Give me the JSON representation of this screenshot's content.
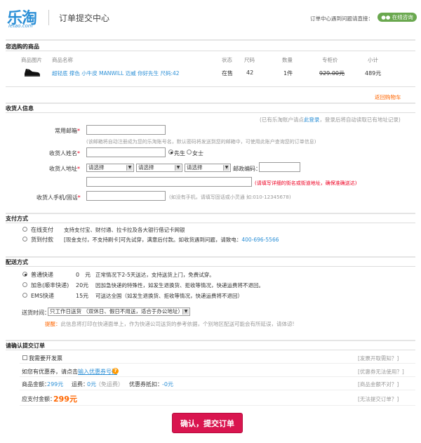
{
  "header": {
    "logo_cn": "乐淘",
    "logo_en": "letao.com",
    "title": "订单提交中心",
    "help_text": "订单中心遇到问题请直接：",
    "online_label": "在线咨询"
  },
  "products": {
    "section_title": "您选购的商品",
    "columns": [
      "商品图片",
      "商品名称",
      "状态",
      "尺码",
      "数量",
      "专柜价",
      "小计"
    ],
    "item": {
      "name": "超轻底 撑色 小牛皮 MANWILL 迈威 你好先生 尺码:42",
      "status": "在售",
      "size": "42",
      "quantity": "1件",
      "list_price": "929.00元",
      "subtotal": "489元"
    },
    "back_link": "返回购物车"
  },
  "receiver": {
    "section_title": "收货人信息",
    "login_hint_prefix": "(已有乐淘账户请点",
    "login_link": "此登录",
    "login_hint_suffix": "，登录后将自动读取已有地址记录)",
    "email_label": "常用邮箱",
    "email_hint": "(该邮箱将自动注册成为您的乐淘账号名，默认密码将发送到您的邮箱中，可使用此账户查询您的订单信息)",
    "name_label": "收货人姓名",
    "gender_male": "先生",
    "gender_female": "女士",
    "address_label": "收货人地址",
    "province_placeholder": "请选择",
    "city_placeholder": "请选择",
    "district_placeholder": "请选择",
    "zip_label": "邮政编码：",
    "address_hint": "(请填写详细的街名或街道地址，确保准确送达)",
    "phone_label": "收货人手机/固话",
    "phone_hint": "(如没有手机，请填写固话或小灵通 如:010-12345678)"
  },
  "payment": {
    "section_title": "支付方式",
    "options": [
      {
        "label": "在线支付",
        "desc": "支持支付宝、财付通、拉卡拉及各大银行借记卡网银"
      },
      {
        "label": "货到付款",
        "desc": "[现金支付，不支持刷卡]可先试穿，满意后付款。如收货遇到问题，请致电：",
        "phone": "400-696-5566"
      }
    ]
  },
  "delivery": {
    "section_title": "配送方式",
    "options": [
      {
        "label": "普通快递",
        "fee": "0　元",
        "desc": "正常情况下2-5天送达，支持送货上门，免费试穿。"
      },
      {
        "label": "加急(顺丰快递)",
        "fee": "20元",
        "desc": "因加急快递的特殊性，如发生退换货、拒收等情况，快递运费将不退回。"
      },
      {
        "label": "EMS快递",
        "fee": "15元",
        "desc": "可送达全国（如发生退换货、拒收等情况，快递运费将不退回）"
      }
    ],
    "time_label": "送货时间：",
    "time_value": "只工作日送货 （双休日、假日不用送，适合于办公地址）",
    "reminder_label": "提醒：",
    "reminder_text": "此信息将打印在快递面单上，作为快递公司送货的参考依据，个别地区配送可能会有所延误，请体谅!"
  },
  "confirm": {
    "section_title": "请确认提交订单",
    "invoice_label": "我需要开发票",
    "invoice_help": "[发票开取需知？]",
    "coupon_prefix": "如您有优惠券，请点击",
    "coupon_link": "输入优惠券号码",
    "coupon_help": "[优惠券无法使用？]",
    "goods_total_label": "商品金额：",
    "goods_total": "299元",
    "shipping_label": "运费：",
    "shipping_value": "0元",
    "shipping_note": "（免运费）",
    "coupon_discount_label": "优惠券抵扣：",
    "coupon_discount": "-0元",
    "amount_help": "[商品金额不对？]",
    "payable_label": "应支付金额：",
    "payable": "299元",
    "payment_help": "[无法提交订单？]",
    "submit_label": "确认，提交订单"
  }
}
